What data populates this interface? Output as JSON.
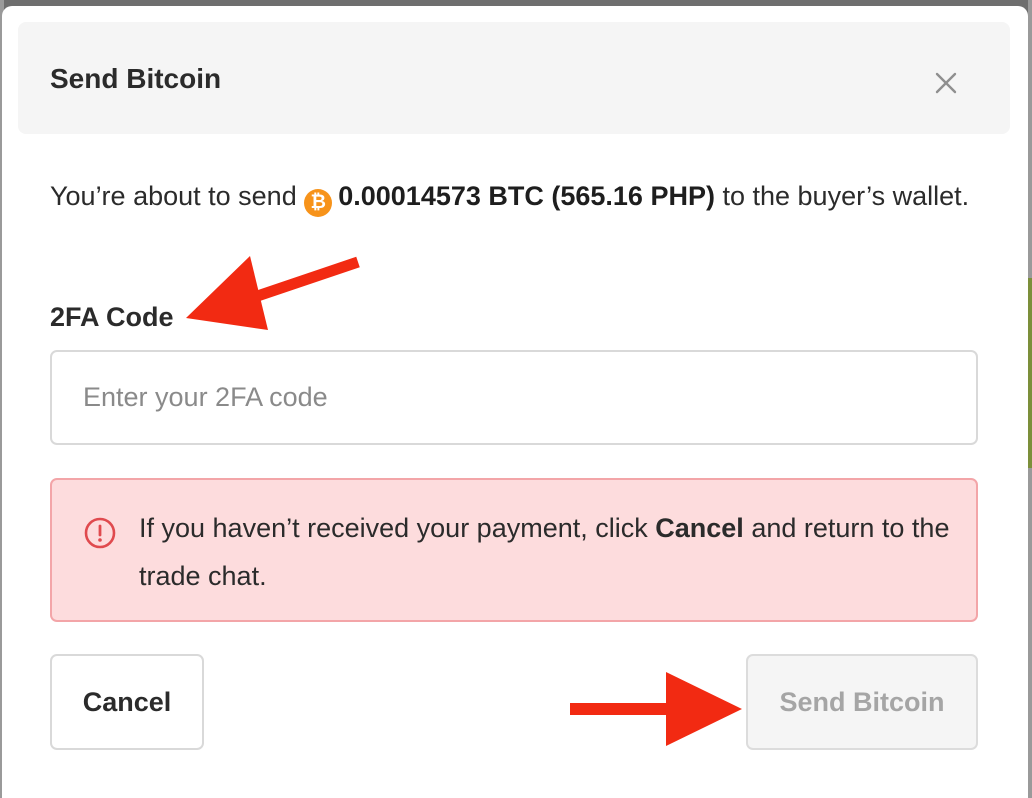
{
  "dialog": {
    "title": "Send Bitcoin",
    "close_label": "×"
  },
  "intro": {
    "prefix": "You’re about to send",
    "btc_symbol": "₿",
    "amount": "0.00014573 BTC (565.16 PHP)",
    "suffix": "to the buyer’s wallet."
  },
  "twofa": {
    "label": "2FA Code",
    "placeholder": "Enter your 2FA code",
    "value": ""
  },
  "alert": {
    "text_before": "If you haven’t received your payment, click",
    "emphasis": "Cancel",
    "text_after": "and return to the trade chat."
  },
  "buttons": {
    "cancel": "Cancel",
    "send": "Send Bitcoin",
    "send_disabled": true
  },
  "colors": {
    "bitcoin": "#f7931a",
    "alert_bg": "#fddcdd",
    "alert_border": "#f3a5a8",
    "alert_icon": "#e04a4e",
    "annotation_arrow": "#f22a12"
  },
  "icons": {
    "close": "close-icon",
    "bitcoin": "bitcoin-icon",
    "alert": "info-circle-icon"
  }
}
